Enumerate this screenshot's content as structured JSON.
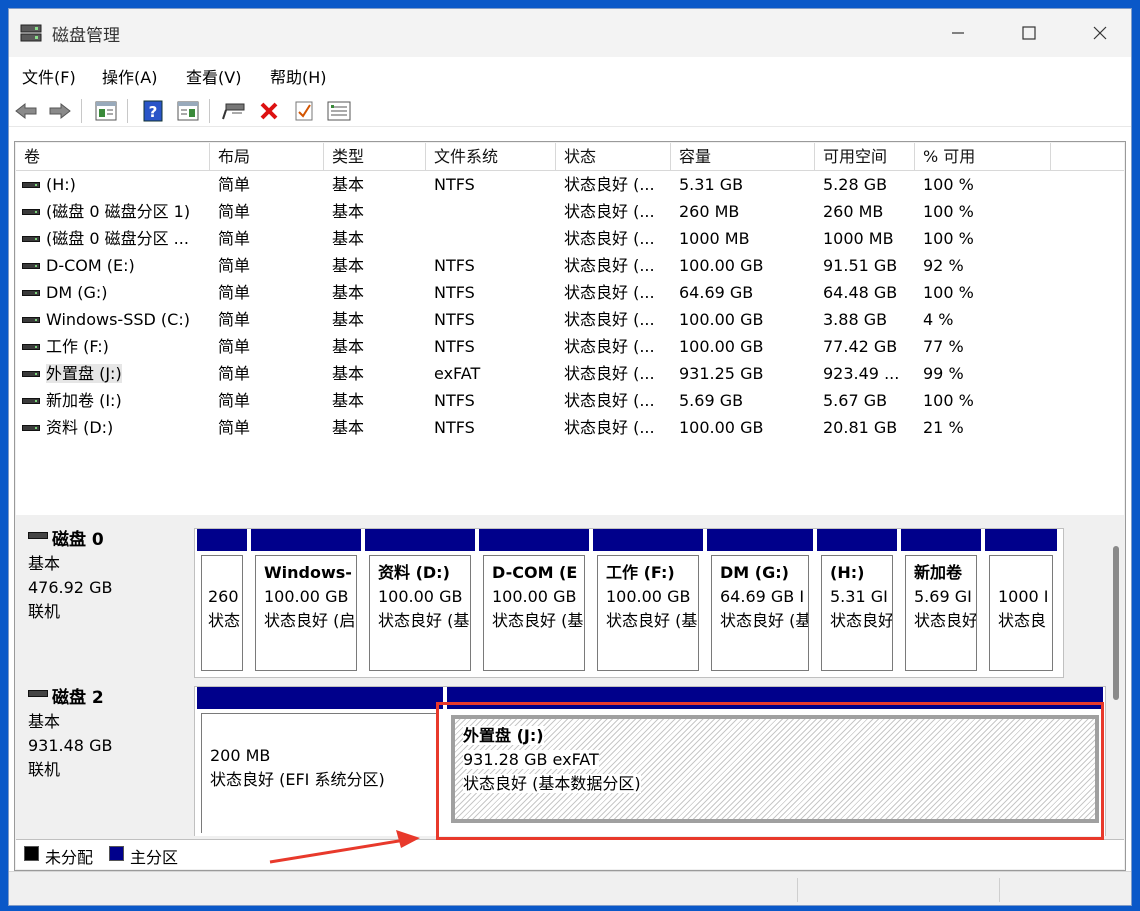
{
  "window": {
    "title": "磁盘管理"
  },
  "menu": [
    "文件(F)",
    "操作(A)",
    "查看(V)",
    "帮助(H)"
  ],
  "toolbar": [
    "back-icon",
    "forward-icon",
    "properties-icon",
    "help-icon",
    "view-icon",
    "connect-icon",
    "delete-icon",
    "check-icon",
    "list-icon"
  ],
  "columns": [
    "卷",
    "布局",
    "类型",
    "文件系统",
    "状态",
    "容量",
    "可用空间",
    "% 可用"
  ],
  "volumes": [
    {
      "name": "(H:)",
      "layout": "简单",
      "type": "基本",
      "fs": "NTFS",
      "status": "状态良好 (...",
      "capacity": "5.31 GB",
      "free": "5.28 GB",
      "pct": "100 %"
    },
    {
      "name": "(磁盘 0 磁盘分区 1)",
      "layout": "简单",
      "type": "基本",
      "fs": "",
      "status": "状态良好 (...",
      "capacity": "260 MB",
      "free": "260 MB",
      "pct": "100 %"
    },
    {
      "name": "(磁盘 0 磁盘分区 ...",
      "layout": "简单",
      "type": "基本",
      "fs": "",
      "status": "状态良好 (...",
      "capacity": "1000 MB",
      "free": "1000 MB",
      "pct": "100 %"
    },
    {
      "name": "D-COM (E:)",
      "layout": "简单",
      "type": "基本",
      "fs": "NTFS",
      "status": "状态良好 (...",
      "capacity": "100.00 GB",
      "free": "91.51 GB",
      "pct": "92 %"
    },
    {
      "name": "DM (G:)",
      "layout": "简单",
      "type": "基本",
      "fs": "NTFS",
      "status": "状态良好 (...",
      "capacity": "64.69 GB",
      "free": "64.48 GB",
      "pct": "100 %"
    },
    {
      "name": "Windows-SSD (C:)",
      "layout": "简单",
      "type": "基本",
      "fs": "NTFS",
      "status": "状态良好 (...",
      "capacity": "100.00 GB",
      "free": "3.88 GB",
      "pct": "4 %"
    },
    {
      "name": "工作 (F:)",
      "layout": "简单",
      "type": "基本",
      "fs": "NTFS",
      "status": "状态良好 (...",
      "capacity": "100.00 GB",
      "free": "77.42 GB",
      "pct": "77 %"
    },
    {
      "name": "外置盘 (J:)",
      "layout": "简单",
      "type": "基本",
      "fs": "exFAT",
      "status": "状态良好 (...",
      "capacity": "931.25 GB",
      "free": "923.49 ...",
      "pct": "99 %"
    },
    {
      "name": "新加卷 (I:)",
      "layout": "简单",
      "type": "基本",
      "fs": "NTFS",
      "status": "状态良好 (...",
      "capacity": "5.69 GB",
      "free": "5.67 GB",
      "pct": "100 %"
    },
    {
      "name": "资料 (D:)",
      "layout": "简单",
      "type": "基本",
      "fs": "NTFS",
      "status": "状态良好 (...",
      "capacity": "100.00 GB",
      "free": "20.81 GB",
      "pct": "21 %"
    }
  ],
  "disks": [
    {
      "name": "磁盘 0",
      "type": "基本",
      "size": "476.92 GB",
      "state": "联机",
      "partitions": [
        {
          "name": "",
          "size": "260",
          "status": "状态"
        },
        {
          "name": "Windows-",
          "size": "100.00 GB",
          "status": "状态良好 (启"
        },
        {
          "name": "资料 (D:)",
          "size": "100.00 GB",
          "status": "状态良好 (基"
        },
        {
          "name": "D-COM (E",
          "size": "100.00 GB",
          "status": "状态良好 (基"
        },
        {
          "name": "工作 (F:)",
          "size": "100.00 GB",
          "status": "状态良好 (基"
        },
        {
          "name": "DM (G:)",
          "size": "64.69 GB I",
          "status": "状态良好 (基"
        },
        {
          "name": "(H:)",
          "size": "5.31 GI",
          "status": "状态良好"
        },
        {
          "name": "新加卷",
          "size": "5.69 GI",
          "status": "状态良好"
        },
        {
          "name": "",
          "size": "1000 I",
          "status": "状态良"
        }
      ]
    },
    {
      "name": "磁盘 2",
      "type": "基本",
      "size": "931.48 GB",
      "state": "联机",
      "partitions": [
        {
          "name": "",
          "size": "200 MB",
          "status": "状态良好 (EFI 系统分区)"
        },
        {
          "name": "外置盘 (J:)",
          "size": "931.28 GB exFAT",
          "status": "状态良好 (基本数据分区)"
        }
      ]
    }
  ],
  "legend": [
    {
      "label": "未分配",
      "color": "#000000"
    },
    {
      "label": "主分区",
      "color": "#00008b"
    }
  ],
  "colors": {
    "primary_partition": "#00008b",
    "highlight": "#e8392b"
  }
}
